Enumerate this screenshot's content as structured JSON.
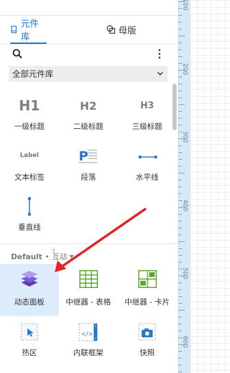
{
  "tabs": [
    {
      "label": "元件库",
      "icon": "book-icon",
      "active": true
    },
    {
      "label": "母版",
      "icon": "masters-icon",
      "active": false
    }
  ],
  "library_select": {
    "value": "全部元件库"
  },
  "widgets": [
    {
      "label": "一级标题",
      "preview": "H1"
    },
    {
      "label": "二级标题",
      "preview": "H2"
    },
    {
      "label": "三级标题",
      "preview": "H3"
    },
    {
      "label": "文本标签",
      "preview": "Label"
    },
    {
      "label": "段落",
      "preview": "P"
    },
    {
      "label": "水平线",
      "preview": ""
    },
    {
      "label": "垂直线",
      "preview": ""
    }
  ],
  "section": {
    "name": "Default",
    "separator": "•",
    "filter": "互动",
    "help": "?"
  },
  "interactive_widgets": [
    {
      "label": "动态面板"
    },
    {
      "label": "中继器 - 表格"
    },
    {
      "label": "中继器 - 卡片"
    },
    {
      "label": "热区"
    },
    {
      "label": "内联框架"
    },
    {
      "label": "快照"
    }
  ],
  "ruler": {
    "labels": [
      "100",
      "200",
      "300",
      "400",
      "500",
      "600"
    ]
  },
  "colors": {
    "accent": "#1a73d9",
    "arrow": "#e3231f",
    "selected": "#dcecfb",
    "green": "#5aa832"
  }
}
